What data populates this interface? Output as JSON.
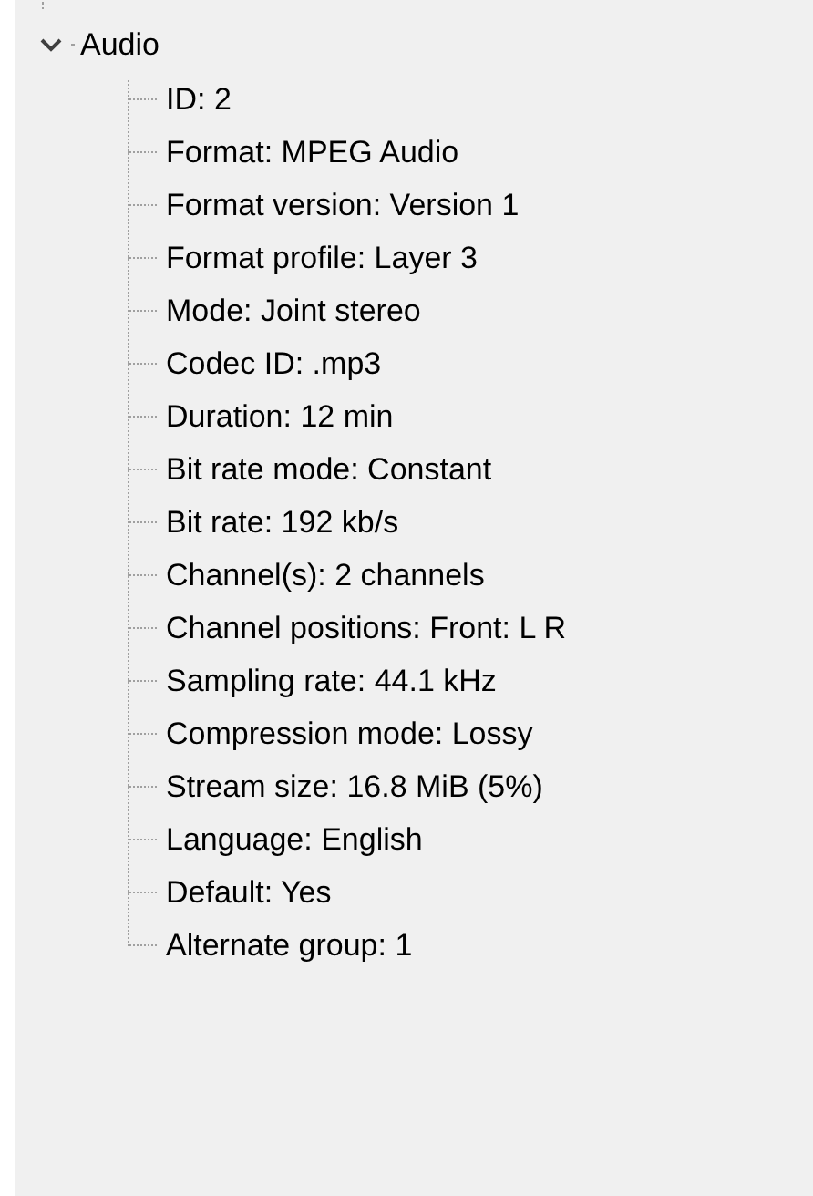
{
  "tree": [
    {
      "label": "Audio",
      "expanded": true,
      "children": [
        {
          "label": "ID: 2"
        },
        {
          "label": "Format: MPEG Audio"
        },
        {
          "label": "Format version: Version 1"
        },
        {
          "label": "Format profile: Layer 3"
        },
        {
          "label": "Mode: Joint stereo"
        },
        {
          "label": "Codec ID: .mp3"
        },
        {
          "label": "Duration: 12 min"
        },
        {
          "label": "Bit rate mode: Constant"
        },
        {
          "label": "Bit rate: 192 kb/s"
        },
        {
          "label": "Channel(s): 2 channels"
        },
        {
          "label": "Channel positions: Front: L R"
        },
        {
          "label": "Sampling rate: 44.1 kHz"
        },
        {
          "label": "Compression mode: Lossy"
        },
        {
          "label": "Stream size: 16.8 MiB (5%)"
        },
        {
          "label": "Language: English"
        },
        {
          "label": "Default: Yes"
        },
        {
          "label": "Alternate group: 1"
        }
      ]
    }
  ]
}
